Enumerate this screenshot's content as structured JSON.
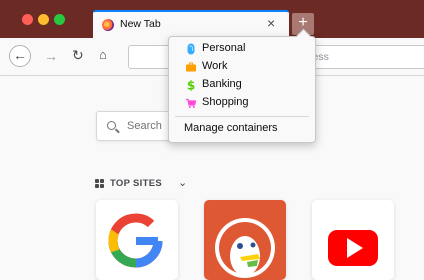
{
  "window": {
    "controls": [
      "close",
      "minimize",
      "zoom"
    ]
  },
  "tab": {
    "title": "New Tab",
    "favicon": "firefox-icon",
    "close_glyph": "×"
  },
  "toolbar": {
    "new_tab_glyph": "+",
    "back_glyph": "←",
    "forward_glyph": "→",
    "reload_glyph": "↻",
    "home_glyph": "⌂",
    "url_placeholder_visible": "ress"
  },
  "container_menu": {
    "items": [
      {
        "label": "Personal",
        "icon": "fingerprint-icon",
        "color": "#37adff"
      },
      {
        "label": "Work",
        "icon": "briefcase-icon",
        "color": "#ff9f00"
      },
      {
        "label": "Banking",
        "icon": "dollar-icon",
        "color": "#51cd00"
      },
      {
        "label": "Shopping",
        "icon": "cart-icon",
        "color": "#ff4bda"
      }
    ],
    "manage_label": "Manage containers"
  },
  "search": {
    "placeholder": "Search"
  },
  "top_sites": {
    "heading": "TOP SITES",
    "chevron": "⌄",
    "tiles": [
      {
        "site": "google",
        "icon": "google-icon"
      },
      {
        "site": "duckduckgo",
        "icon": "duckduckgo-icon"
      },
      {
        "site": "youtube",
        "icon": "youtube-icon"
      }
    ]
  },
  "colors": {
    "tabbar": "#6b2a24",
    "accent": "#0a84ff",
    "page_bg": "#f9f9fa"
  }
}
